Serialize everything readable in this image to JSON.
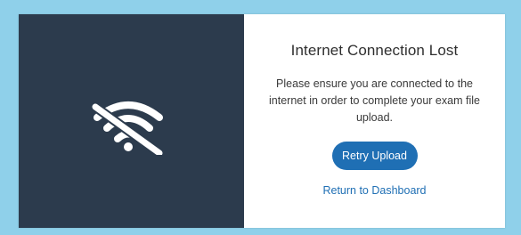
{
  "dialog": {
    "title": "Internet Connection Lost",
    "message": "Please ensure you are connected to the internet in order to complete your exam file upload.",
    "retry_label": "Retry Upload",
    "dashboard_label": "Return to Dashboard",
    "icon": "wifi-off-icon"
  },
  "colors": {
    "background": "#8fd0ea",
    "panel": "#2c3b4d",
    "accent": "#1f6fb4"
  }
}
